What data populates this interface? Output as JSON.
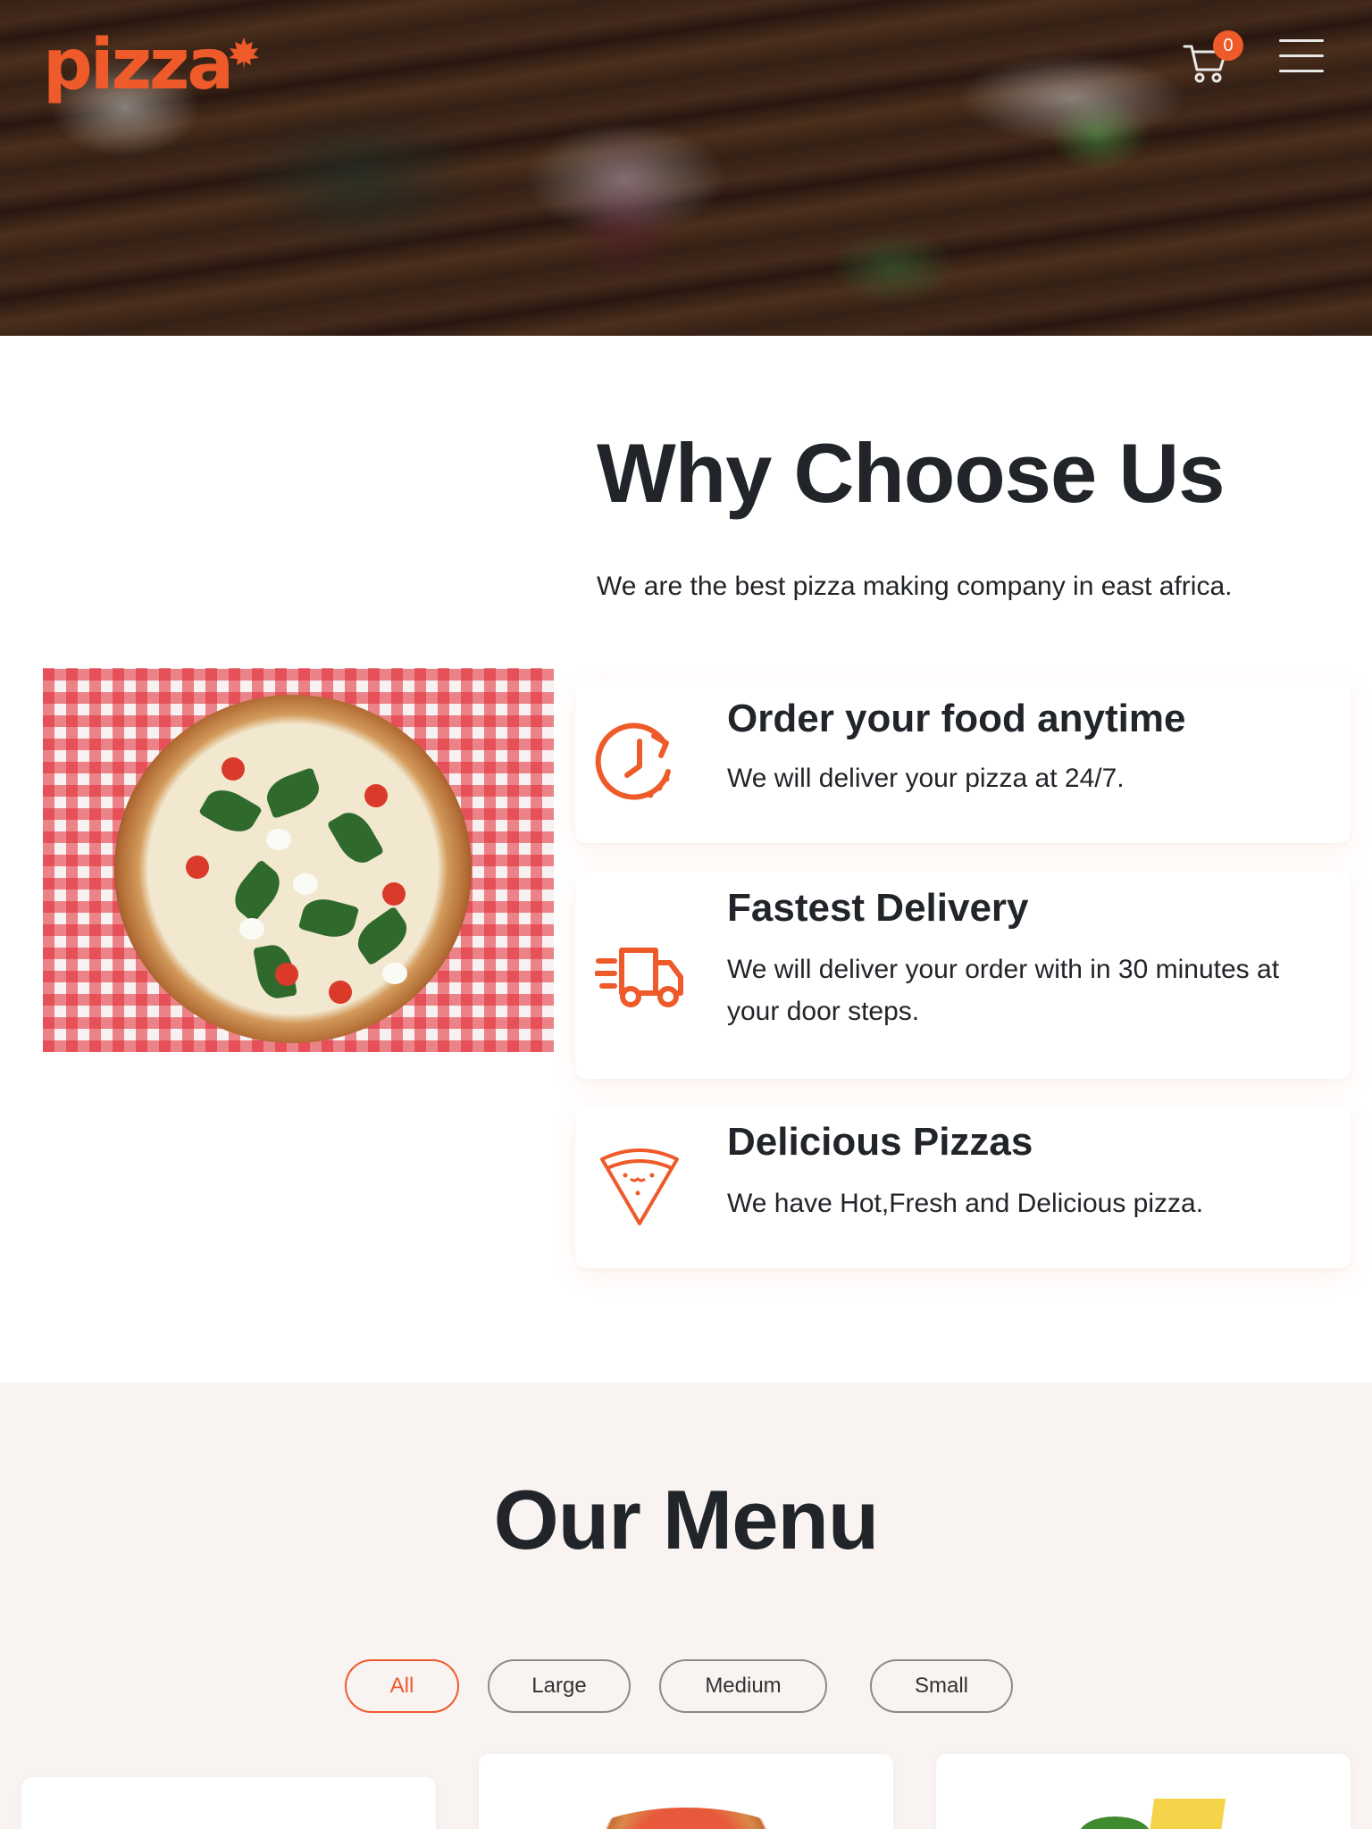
{
  "header": {
    "logo_text": "pizza",
    "cart_count": "0",
    "cart_icon": "cart-icon",
    "menu_icon": "hamburger-icon"
  },
  "why": {
    "title": "Why Choose Us",
    "subtitle": "We are the best pizza making company in east africa.",
    "features": [
      {
        "icon": "clock-icon",
        "title": "Order your food anytime",
        "text": "We will deliver your pizza at 24/7."
      },
      {
        "icon": "delivery-truck-icon",
        "title": "Fastest Delivery",
        "text": "We will deliver your order with in 30 minutes at your door steps."
      },
      {
        "icon": "pizza-slice-icon",
        "title": "Delicious Pizzas",
        "text": "We have Hot,Fresh and Delicious pizza."
      }
    ]
  },
  "menu": {
    "title": "Our Menu",
    "filters": [
      "All",
      "Large",
      "Medium",
      "Small"
    ],
    "active_filter": "All"
  },
  "colors": {
    "accent": "#ee5a2a",
    "text": "#212529",
    "menu_bg": "#f9f3f2"
  }
}
